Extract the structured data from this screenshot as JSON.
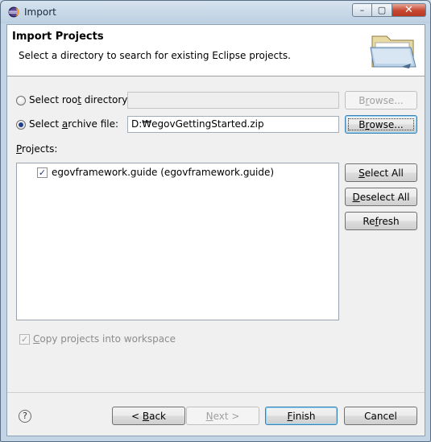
{
  "window": {
    "title": "Import",
    "icon": "eclipse-icon",
    "caption_buttons": {
      "minimize": "–",
      "maximize": "▢",
      "close": "✕"
    }
  },
  "banner": {
    "title": "Import Projects",
    "description": "Select a directory to search for existing Eclipse projects.",
    "icon": "folder-icon"
  },
  "source": {
    "root_dir_label_pre": "Select roo",
    "root_dir_label_key": "t",
    "root_dir_label_post": " directory:",
    "root_dir_value": "",
    "root_dir_selected": false,
    "archive_label_pre": "Select ",
    "archive_label_key": "a",
    "archive_label_post": "rchive file:",
    "archive_value": "D:₩egovGettingStarted.zip",
    "archive_selected": true,
    "browse_label_pre": "B",
    "browse_label_key": "r",
    "browse_label_post": "owse..."
  },
  "projects": {
    "label_key": "P",
    "label_post": "rojects:",
    "items": [
      {
        "label": "egovframework.guide (egovframework.guide)",
        "checked": true
      }
    ]
  },
  "side_buttons": {
    "select_all_pre": "",
    "select_all_key": "S",
    "select_all_post": "elect All",
    "deselect_all_key": "D",
    "deselect_all_post": "eselect All",
    "refresh_pre": "Re",
    "refresh_key": "f",
    "refresh_post": "resh"
  },
  "options": {
    "copy_key": "C",
    "copy_post": "opy projects into workspace",
    "copy_checked": true,
    "copy_enabled": false
  },
  "footer": {
    "help_symbol": "?",
    "back_pre": "< ",
    "back_key": "B",
    "back_post": "ack",
    "next_pre": "",
    "next_key": "N",
    "next_post": "ext >",
    "finish_key": "F",
    "finish_post": "inish",
    "cancel_label": "Cancel"
  }
}
